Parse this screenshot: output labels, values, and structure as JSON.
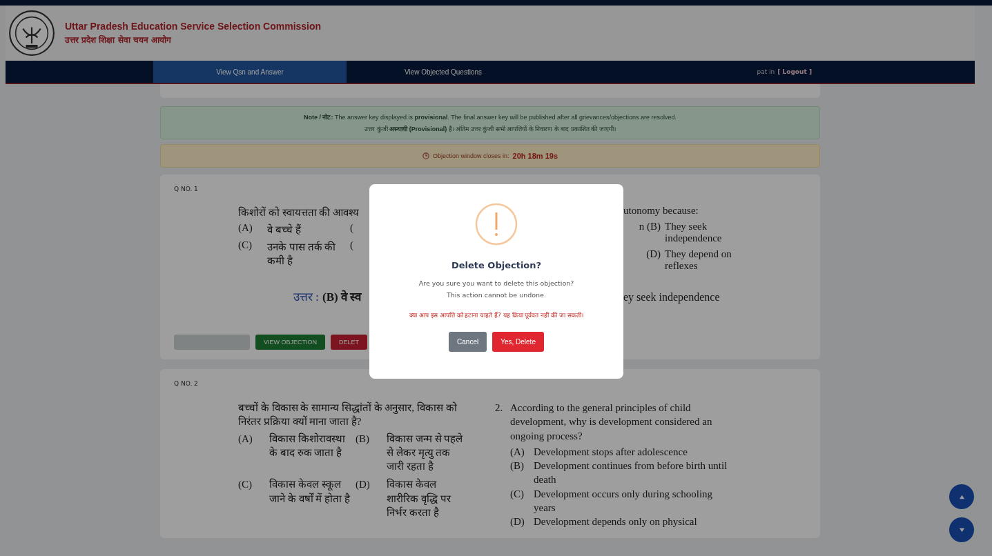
{
  "header": {
    "title_en": "Uttar Pradesh Education Service Selection Commission",
    "title_hi": "उत्तर प्रदेश शिक्षा सेवा चयन आयोग"
  },
  "nav": {
    "tabs": [
      {
        "label": "View Qsn and Answer",
        "selected": true
      },
      {
        "label": "View Objected Questions",
        "selected": false
      }
    ],
    "user": "pat in",
    "logout": "[ Logout ]"
  },
  "notice": {
    "text": "**Note / नोट:** The answer key displayed is **provisional**. The final answer key will be published after all grievances/objections are resolved.",
    "text_hi": "उत्तर कुंजी **अस्थायी (Provisional)** है। अंतिम उत्तर कुंजी सभी आपत्तियों के निवारण के बाद प्रकाशित की जाएगी।"
  },
  "countdown": {
    "label": "Objection window closes in:",
    "time": "20h 18m 19s"
  },
  "question_1": {
    "number": "Q NO. 1",
    "question_head": "किशोरों को स्वायत्तता की आवश्य",
    "left_options": [
      {
        "label": "(A)",
        "text": "वे बच्चे हैं",
        "next": "("
      },
      {
        "label": "(C)",
        "text": "उनके पास तर्क की कमी है",
        "next": "("
      }
    ],
    "question_tail": "utonomy because:",
    "right_options": [
      {
        "prefix": "n",
        "label": "(B)",
        "text": "They seek independence"
      },
      {
        "label": "(D)",
        "text": "They depend on reflexes"
      }
    ],
    "answer_label": "उत्तर :",
    "answer_left": "(B) वे स्व",
    "answer_right": "ey seek independence",
    "buttons": [
      {
        "kind": "raise",
        "disabled": true
      },
      {
        "label": "VIEW OBJECTION",
        "kind": "view",
        "disabled": false
      },
      {
        "label": "DELET",
        "kind": "delete",
        "disabled": false
      }
    ]
  },
  "question_2": {
    "number": "Q NO. 2",
    "hi": {
      "question": "बच्चों के विकास के सामान्य सिद्धांतों के अनुसार, विकास को निरंतर प्रक्रिया क्यों माना जाता है?",
      "options": [
        {
          "label": "(A)",
          "text": "विकास किशोरावस्था के बाद रुक जाता है"
        },
        {
          "label": "(B)",
          "text": "विकास जन्म से पहले से लेकर मृत्यु तक जारी रहता है"
        },
        {
          "label": "(C)",
          "text": "विकास केवल स्कूल जाने के वर्षों में होता है"
        },
        {
          "label": "(D)",
          "text": "विकास केवल शारीरिक वृद्धि पर निर्भर करता है"
        }
      ]
    },
    "en": {
      "index": "2.",
      "question": "According to the general principles of child development, why is development considered an ongoing process?",
      "options": [
        {
          "label": "(A)",
          "text": "Development stops after adolescence"
        },
        {
          "label": "(B)",
          "text": "Development continues from before birth until death"
        },
        {
          "label": "(C)",
          "text": "Development occurs only during schooling years"
        },
        {
          "label": "(D)",
          "text": "Development depends only on physical"
        }
      ]
    }
  },
  "modal": {
    "title": "Delete Objection?",
    "message": [
      "Are you sure you want to delete this objection?",
      "This action cannot be undone."
    ],
    "message_hi": "क्या आप इस आपत्ति को हटाना चाहते हैं? यह क्रिया पूर्ववत नहीं की जा सकती।",
    "buttons": [
      {
        "label": "Cancel",
        "kind": "cancel"
      },
      {
        "label": "Yes, Delete",
        "kind": "danger"
      }
    ]
  }
}
